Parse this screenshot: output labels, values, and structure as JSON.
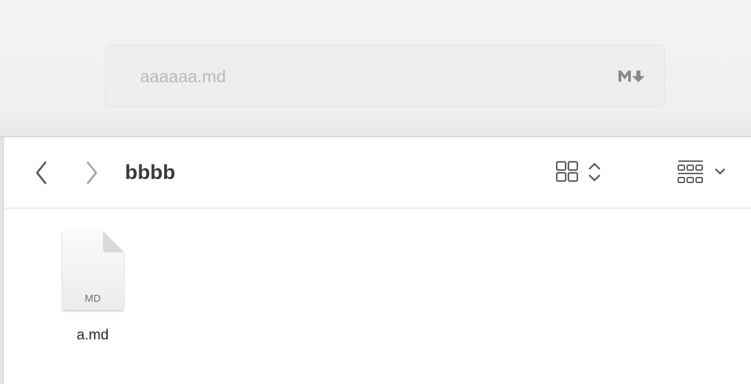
{
  "save_dialog": {
    "filename_value": "",
    "filename_placeholder": "aaaaaa.md",
    "format_badge_icon": "markdown-icon"
  },
  "browser": {
    "folder_title": "bbbb",
    "back_icon": "chevron-left-icon",
    "forward_icon": "chevron-right-icon",
    "view_mode_icon": "icon-grid-view-icon",
    "group_icon": "group-by-icon"
  },
  "files": [
    {
      "name": "a.md",
      "type_label": "MD",
      "icon": "document-icon"
    }
  ],
  "colors": {
    "placeholder": "#b8b8b8",
    "title": "#3b3b3b",
    "icon_active": "#5c5c5c",
    "icon_disabled": "#a8a8a8"
  }
}
